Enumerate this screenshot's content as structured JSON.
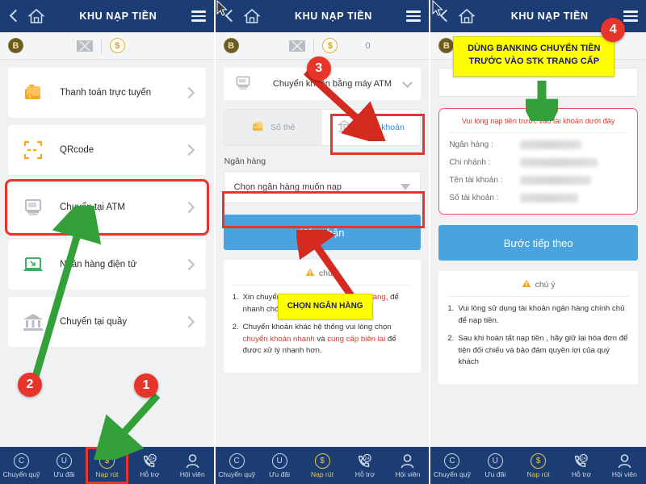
{
  "panels": [
    {
      "id": "panel-1",
      "header": {
        "title": "KHU NẠP TIỀN",
        "back_icon": "chevron-left-icon",
        "home_icon": "home-icon",
        "menu_icon": "hamburger-menu-icon"
      },
      "subbar": {
        "badge": "B",
        "mail_icon": "envelope-icon",
        "coin_icon": "coin-dollar-icon",
        "count": ""
      },
      "menu_items": [
        {
          "label": "Thanh toán trực tuyến",
          "icon": "card-payment-icon",
          "highlighted": false
        },
        {
          "label": "QRcode",
          "icon": "qr-code-icon",
          "highlighted": false
        },
        {
          "label": "Chuyển tại ATM",
          "icon": "atm-machine-icon",
          "highlighted": true
        },
        {
          "label": "Ngân hàng điện tử",
          "icon": "laptop-icon",
          "highlighted": false
        },
        {
          "label": "Chuyển tại quầy",
          "icon": "bank-building-icon",
          "highlighted": false
        }
      ]
    },
    {
      "id": "panel-2",
      "header": {
        "title": "KHU NẠP TIỀN",
        "back_icon": "chevron-left-icon",
        "home_icon": "home-icon",
        "menu_icon": "hamburger-menu-icon"
      },
      "subbar": {
        "badge": "B",
        "mail_icon": "envelope-icon",
        "coin_icon": "coin-dollar-icon",
        "count": "0"
      },
      "method_select": {
        "value": "Chuyển khoản bằng máy ATM",
        "icon": "atm-machine-icon",
        "chevron": "chevron-down-icon"
      },
      "tabs": [
        {
          "label": "Số thẻ",
          "icon": "card-icon",
          "active": false
        },
        {
          "label": "Số tài khoản",
          "icon": "bank-building-icon",
          "active": true
        }
      ],
      "bank_field": {
        "label": "Ngân hàng",
        "placeholder": "Chọn ngân hàng muốn nạp",
        "caret": "triangle-down-icon"
      },
      "submit_label": "Xác nhận",
      "notes": {
        "heading": "chú ý",
        "heading_icon": "warning-triangle-icon",
        "items": [
          {
            "num": "1.",
            "parts": [
              {
                "t": "Xin chuyển tiền ",
                "red": false
              },
              {
                "t": "cùng hệ thống ngân hàng",
                "red": true
              },
              {
                "t": ", để nhanh chóng nạp điểm vào tài khoản.",
                "red": false
              }
            ]
          },
          {
            "num": "2.",
            "parts": [
              {
                "t": "Chuyển khoản khác hệ thống vui lòng chọn ",
                "red": false
              },
              {
                "t": "chuyển khoản nhanh",
                "red": true
              },
              {
                "t": " và ",
                "red": false
              },
              {
                "t": "cung cấp biên lai",
                "red": true
              },
              {
                "t": " để được xử lý nhanh hơn.",
                "red": false
              }
            ]
          }
        ]
      }
    },
    {
      "id": "panel-3",
      "header": {
        "title": "KHU NẠP TIỀN",
        "back_icon": "chevron-left-icon",
        "home_icon": "home-icon",
        "menu_icon": "hamburger-menu-icon"
      },
      "subbar": {
        "badge": "B",
        "mail_icon": "envelope-icon",
        "coin_icon": "coin-dollar-icon",
        "count": ""
      },
      "account_card": {
        "title": "Vui lòng nạp tiền trước vào tài khoản dưới đây",
        "rows": [
          {
            "key": "Ngân hàng :",
            "value": "",
            "masked": true
          },
          {
            "key": "Chi nhánh :",
            "value": "",
            "masked": true
          },
          {
            "key": "Tên tài khoản :",
            "value": "",
            "masked": true
          },
          {
            "key": "Số tài khoản :",
            "value": "",
            "masked": true
          }
        ]
      },
      "next_label": "Bước tiếp theo",
      "notes": {
        "heading": "chú ý",
        "heading_icon": "warning-triangle-icon",
        "items": [
          {
            "num": "1.",
            "parts": [
              {
                "t": "Vui lòng sử dụng tài khoản ngân hàng chính chủ để nạp tiền.",
                "red": false
              }
            ]
          },
          {
            "num": "2.",
            "parts": [
              {
                "t": "Sau khi hoàn tất nạp tiền , hãy giữ lại hóa đơn để tiện đối chiếu và bảo đảm quyền lợi của quý khách",
                "red": false
              }
            ]
          }
        ]
      }
    }
  ],
  "bottom_nav": [
    {
      "label": "Chuyển quỹ",
      "glyph": "C",
      "icon": "circle-c-icon",
      "active": false
    },
    {
      "label": "Ưu đãi",
      "glyph": "U",
      "icon": "circle-u-icon",
      "active": false
    },
    {
      "label": "Nạp rút",
      "glyph": "$",
      "icon": "coin-dollar-icon",
      "active": true
    },
    {
      "label": "Hỗ trợ",
      "glyph": "24",
      "icon": "phone-24h-icon",
      "active": false
    },
    {
      "label": "Hội viên",
      "glyph": "",
      "icon": "user-person-icon",
      "active": false
    }
  ],
  "annotations": {
    "badges": [
      {
        "text": "1",
        "panel": 1
      },
      {
        "text": "2",
        "panel": 1
      },
      {
        "text": "3",
        "panel": 2
      },
      {
        "text": "4",
        "panel": 3
      }
    ],
    "callouts": [
      {
        "text": "CHỌN NGÂN HÀNG",
        "panel": 2
      },
      {
        "line1": "DÙNG BANKING CHUYỂN TIỀN",
        "line2": "TRƯỚC VÀO STK TRANG CẤP",
        "panel": 3
      }
    ],
    "colors": {
      "badge_red": "#e8352c",
      "highlight_red": "#e8352c",
      "arrow_green": "#34a03a",
      "arrow_red": "#d42a20",
      "callout_yellow": "#ffff00",
      "header_blue": "#1c3d73",
      "button_blue": "#4aa3df",
      "accent_gold": "#e8c84e"
    }
  }
}
